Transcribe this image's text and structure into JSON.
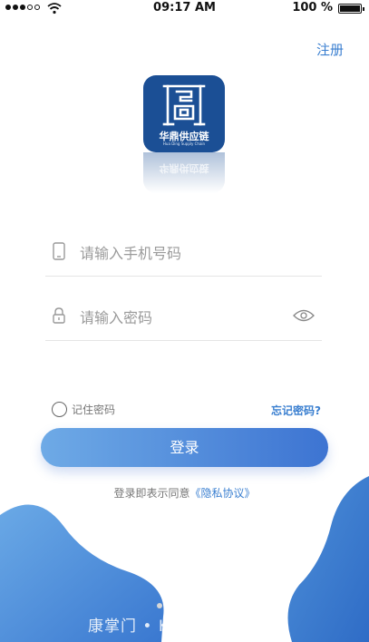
{
  "status_bar": {
    "time": "09:17 AM",
    "battery": "100 %"
  },
  "header": {
    "register": "注册"
  },
  "logo": {
    "name_cn": "华鼎供应链",
    "name_en": "Hua Ding Supply Chain"
  },
  "form": {
    "phone_placeholder": "请输入手机号码",
    "password_placeholder": "请输入密码",
    "remember_label": "记住密码",
    "forgot_label": "忘记密码?",
    "login_label": "登录"
  },
  "agreement": {
    "prefix": "登录即表示同意",
    "link": "《隐私协议》"
  },
  "watermark": "康掌门 • KANGZM.COM",
  "colors": {
    "accent": "#3a7fd0",
    "logo_bg": "#1b4f95",
    "wave": "#4d8fd8"
  }
}
